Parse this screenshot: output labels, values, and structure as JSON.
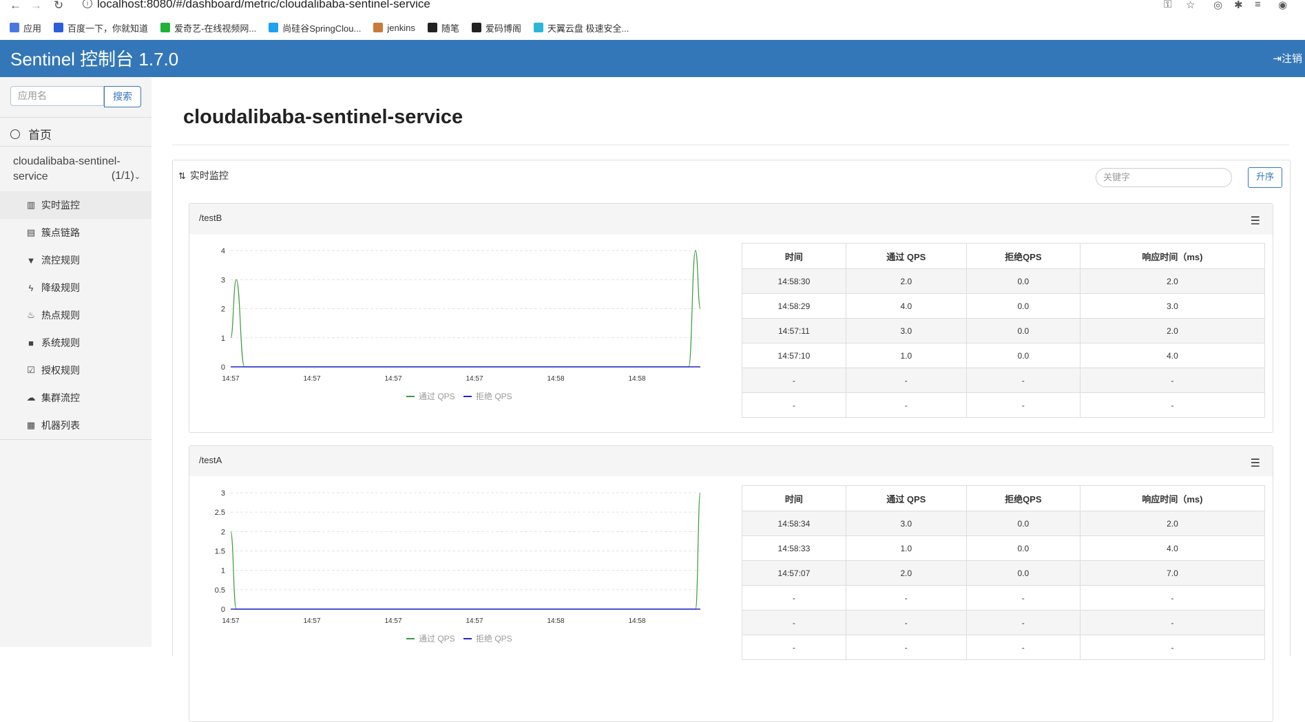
{
  "browser": {
    "url": "localhost:8080/#/dashboard/metric/cloudalibaba-sentinel-service",
    "bookmarks": [
      {
        "label": "应用",
        "color": "#4a78e0"
      },
      {
        "label": "百度一下，你就知道",
        "color": "#2b5fd9"
      },
      {
        "label": "爱奇艺-在线视频网...",
        "color": "#21b235"
      },
      {
        "label": "尚硅谷SpringClou...",
        "color": "#1da1f2"
      },
      {
        "label": "jenkins",
        "color": "#c97a3a"
      },
      {
        "label": "随笔",
        "color": "#222222"
      },
      {
        "label": "爱码博阁",
        "color": "#222222"
      },
      {
        "label": "天翼云盘 极速安全...",
        "color": "#29b6d8"
      }
    ]
  },
  "header": {
    "title": "Sentinel 控制台 1.7.0",
    "logout": "注销"
  },
  "sidebar": {
    "search_placeholder": "应用名",
    "search_button": "搜索",
    "home": "首页",
    "app_name": "cloudalibaba-sentinel-service",
    "app_count": "(1/1)",
    "menu": [
      {
        "label": "实时监控",
        "icon": "bar-chart-icon",
        "active": true
      },
      {
        "label": "簇点链路",
        "icon": "list-icon",
        "active": false
      },
      {
        "label": "流控规则",
        "icon": "filter-icon",
        "active": false
      },
      {
        "label": "降级规则",
        "icon": "bolt-icon",
        "active": false
      },
      {
        "label": "热点规则",
        "icon": "fire-icon",
        "active": false
      },
      {
        "label": "系统规则",
        "icon": "lock-icon",
        "active": false
      },
      {
        "label": "授权规则",
        "icon": "check-icon",
        "active": false
      },
      {
        "label": "集群流控",
        "icon": "cloud-icon",
        "active": false
      },
      {
        "label": "机器列表",
        "icon": "grid-icon",
        "active": false
      }
    ]
  },
  "main": {
    "title": "cloudalibaba-sentinel-service",
    "section_title": "实时监控",
    "keyword_placeholder": "关键字",
    "sort_button": "升序",
    "table_headers": [
      "时间",
      "通过 QPS",
      "拒绝QPS",
      "响应时间（ms)"
    ],
    "legend": [
      "通过 QPS",
      "拒绝 QPS"
    ],
    "colors": {
      "pass": "#3a9a3a",
      "block": "#2222cc"
    }
  },
  "chart_data": [
    {
      "type": "line",
      "title": "/testB",
      "x": [
        "14:57",
        "14:57",
        "14:57",
        "14:57",
        "14:58",
        "14:58"
      ],
      "ylim": [
        0,
        4
      ],
      "yticks": [
        "0",
        "1",
        "2",
        "3",
        "4"
      ],
      "series": [
        {
          "name": "通过 QPS",
          "values": [
            1.0,
            3.0,
            0,
            0,
            0,
            0,
            0,
            0,
            0,
            4.0,
            2.0
          ]
        },
        {
          "name": "拒绝 QPS",
          "values": [
            0,
            0,
            0,
            0,
            0,
            0,
            0,
            0,
            0,
            0,
            0
          ]
        }
      ],
      "rows": [
        [
          "14:58:30",
          "2.0",
          "0.0",
          "2.0"
        ],
        [
          "14:58:29",
          "4.0",
          "0.0",
          "3.0"
        ],
        [
          "14:57:11",
          "3.0",
          "0.0",
          "2.0"
        ],
        [
          "14:57:10",
          "1.0",
          "0.0",
          "4.0"
        ],
        [
          "-",
          "-",
          "-",
          "-"
        ],
        [
          "-",
          "-",
          "-",
          "-"
        ]
      ]
    },
    {
      "type": "line",
      "title": "/testA",
      "x": [
        "14:57",
        "14:57",
        "14:57",
        "14:57",
        "14:58",
        "14:58"
      ],
      "ylim": [
        0,
        3
      ],
      "yticks": [
        "0",
        "0.5",
        "1",
        "1.5",
        "2",
        "2.5",
        "3"
      ],
      "series": [
        {
          "name": "通过 QPS",
          "values": [
            2.0,
            0,
            0,
            0,
            0,
            0,
            0,
            0,
            0,
            0,
            3.0
          ]
        },
        {
          "name": "拒绝 QPS",
          "values": [
            0,
            0,
            0,
            0,
            0,
            0,
            0,
            0,
            0,
            0,
            0
          ]
        }
      ],
      "rows": [
        [
          "14:58:34",
          "3.0",
          "0.0",
          "2.0"
        ],
        [
          "14:58:33",
          "1.0",
          "0.0",
          "4.0"
        ],
        [
          "14:57:07",
          "2.0",
          "0.0",
          "7.0"
        ],
        [
          "-",
          "-",
          "-",
          "-"
        ],
        [
          "-",
          "-",
          "-",
          "-"
        ],
        [
          "-",
          "-",
          "-",
          "-"
        ]
      ]
    }
  ]
}
